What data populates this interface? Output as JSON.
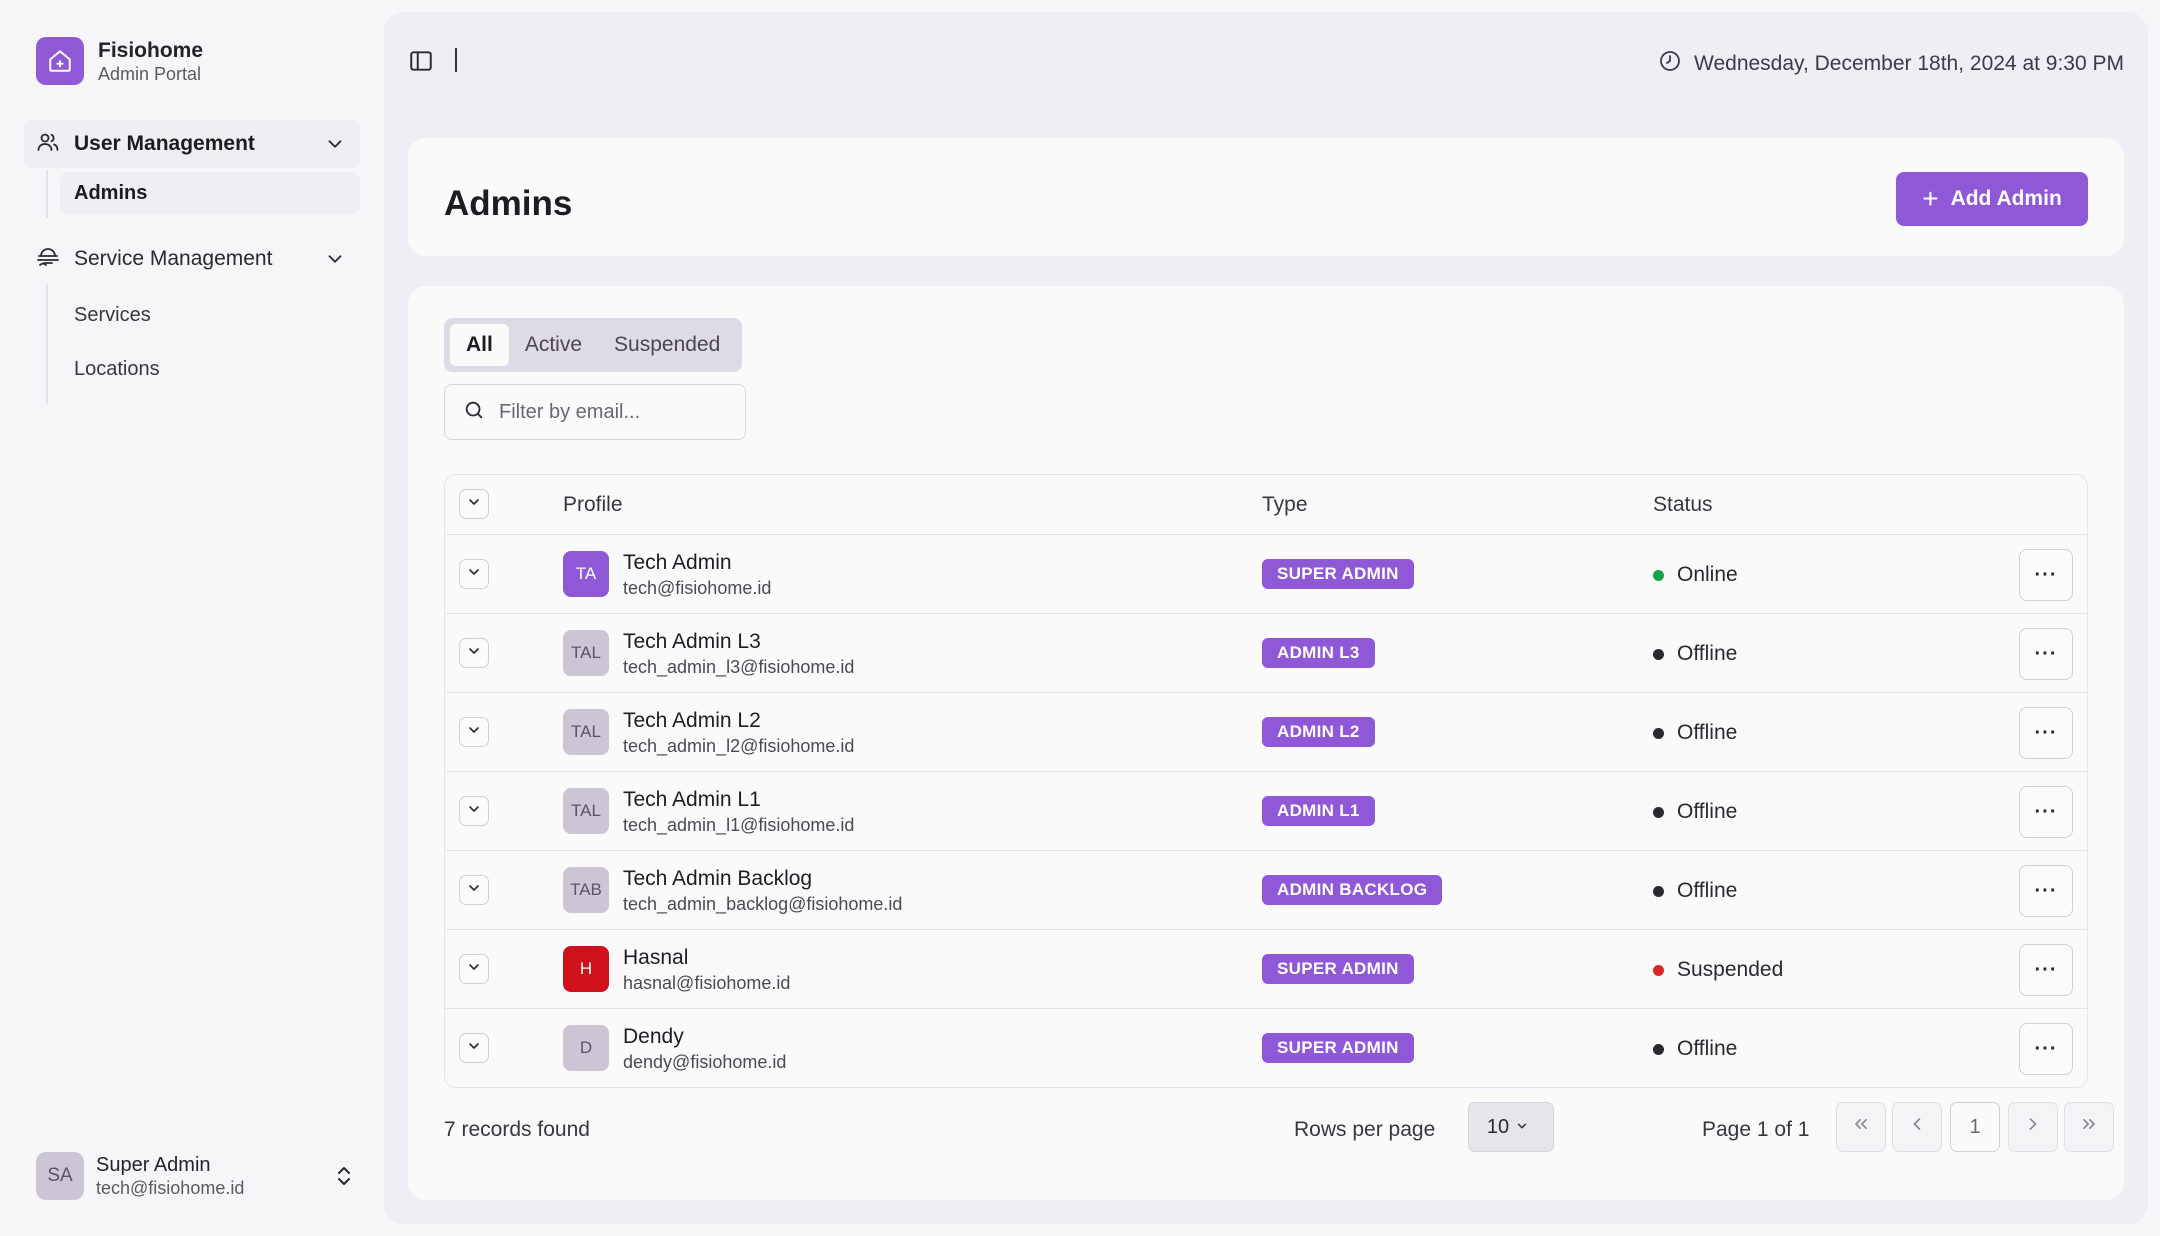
{
  "brand": {
    "name": "Fisiohome",
    "subtitle": "Admin Portal"
  },
  "nav": {
    "user_management": {
      "label": "User Management",
      "items": [
        {
          "label": "Admins"
        }
      ]
    },
    "service_management": {
      "label": "Service Management",
      "items": [
        {
          "label": "Services"
        },
        {
          "label": "Locations"
        }
      ]
    }
  },
  "current_user": {
    "initials": "SA",
    "name": "Super Admin",
    "email": "tech@fisiohome.id"
  },
  "header": {
    "datetime": "Wednesday, December 18th, 2024 at 9:30 PM"
  },
  "page": {
    "title": "Admins",
    "add_button_label": "Add Admin"
  },
  "tabs": [
    {
      "label": "All"
    },
    {
      "label": "Active"
    },
    {
      "label": "Suspended"
    }
  ],
  "search": {
    "placeholder": "Filter by email...",
    "value": ""
  },
  "table": {
    "columns": {
      "profile": "Profile",
      "type": "Type",
      "status": "Status"
    },
    "rows": [
      {
        "initials": "TA",
        "name": "Tech Admin",
        "email": "tech@fisiohome.id",
        "type": "SUPER ADMIN",
        "status": "Online",
        "status_color": "#16a34a",
        "avatar_bg": "#8e58d6",
        "avatar_fg": "#ffffff"
      },
      {
        "initials": "TAL",
        "name": "Tech Admin L3",
        "email": "tech_admin_l3@fisiohome.id",
        "type": "ADMIN L3",
        "status": "Offline",
        "status_color": "#2b2830",
        "avatar_bg": "#cbc5d4",
        "avatar_fg": "#5a5464"
      },
      {
        "initials": "TAL",
        "name": "Tech Admin L2",
        "email": "tech_admin_l2@fisiohome.id",
        "type": "ADMIN L2",
        "status": "Offline",
        "status_color": "#2b2830",
        "avatar_bg": "#cbc5d4",
        "avatar_fg": "#5a5464"
      },
      {
        "initials": "TAL",
        "name": "Tech Admin L1",
        "email": "tech_admin_l1@fisiohome.id",
        "type": "ADMIN L1",
        "status": "Offline",
        "status_color": "#2b2830",
        "avatar_bg": "#cbc5d4",
        "avatar_fg": "#5a5464"
      },
      {
        "initials": "TAB",
        "name": "Tech Admin Backlog",
        "email": "tech_admin_backlog@fisiohome.id",
        "type": "ADMIN BACKLOG",
        "status": "Offline",
        "status_color": "#2b2830",
        "avatar_bg": "#cbc5d4",
        "avatar_fg": "#5a5464"
      },
      {
        "initials": "H",
        "name": "Hasnal",
        "email": "hasnal@fisiohome.id",
        "type": "SUPER ADMIN",
        "status": "Suspended",
        "status_color": "#dc2626",
        "avatar_bg": "#d0111c",
        "avatar_fg": "#ffffff"
      },
      {
        "initials": "D",
        "name": "Dendy",
        "email": "dendy@fisiohome.id",
        "type": "SUPER ADMIN",
        "status": "Offline",
        "status_color": "#2b2830",
        "avatar_bg": "#cbc5d4",
        "avatar_fg": "#5a5464"
      }
    ]
  },
  "footer": {
    "records_text": "7 records found",
    "rows_per_page_label": "Rows per page",
    "rows_per_page_value": "10",
    "page_info": "Page 1 of 1",
    "current_page": "1"
  },
  "colors": {
    "accent": "#8e58d6",
    "online": "#16a34a",
    "suspended": "#dc2626"
  }
}
